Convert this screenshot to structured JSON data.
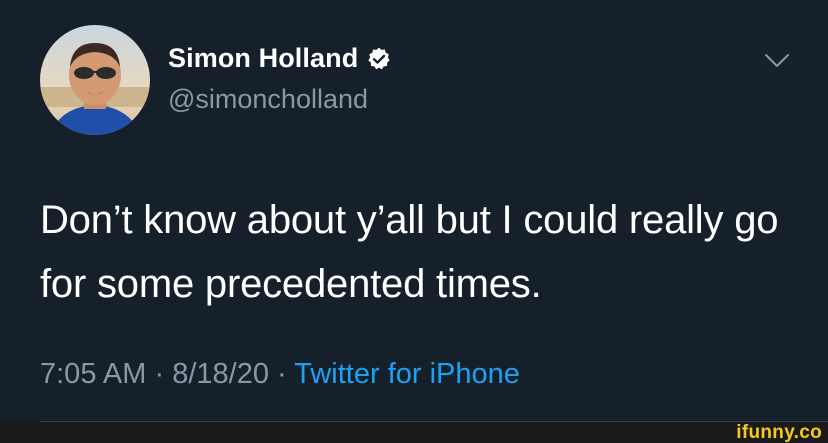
{
  "tweet": {
    "display_name": "Simon Holland",
    "handle": "@simoncholland",
    "text": "Don’t know about y’all but I could really go for some precedented times.",
    "time": "7:05 AM",
    "separator": "·",
    "date": "8/18/20",
    "source": "Twitter for iPhone",
    "verified": true
  },
  "icons": {
    "verified": "verified-badge-icon",
    "menu": "chevron-down-icon"
  },
  "colors": {
    "background": "#15202b",
    "primary_text": "#ffffff",
    "secondary_text": "#8899a6",
    "link": "#1da1f2",
    "watermark": "#f5c918"
  },
  "watermark": {
    "text": "ifunny.co"
  }
}
